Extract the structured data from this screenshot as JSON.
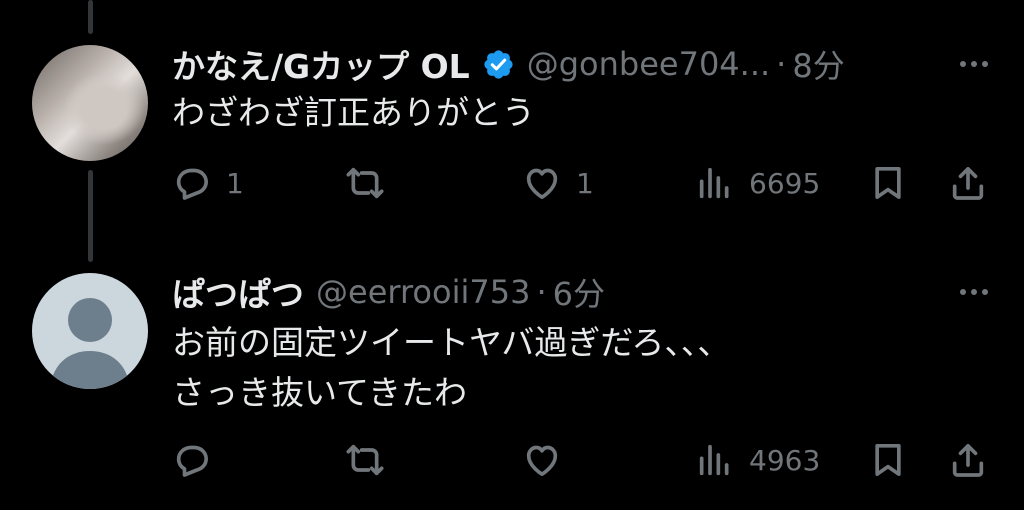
{
  "tweets": [
    {
      "display_name": "かなえ/Gカップ OL",
      "verified": true,
      "handle": "@gonbee704...",
      "dot": "·",
      "time": "8分",
      "text_lines": [
        "わざわざ訂正ありがとう"
      ],
      "reply_count": "1",
      "retweet_count": "",
      "like_count": "1",
      "view_count": "6695"
    },
    {
      "display_name": "ぱつぱつ",
      "verified": false,
      "handle": "@eerrooii753",
      "dot": "·",
      "time": "6分",
      "text_lines": [
        "お前の固定ツイートヤバ過ぎだろ、、、",
        "さっき抜いてきたわ"
      ],
      "reply_count": "",
      "retweet_count": "",
      "like_count": "",
      "view_count": "4963"
    }
  ],
  "icons": {
    "reply": "reply-icon",
    "retweet": "retweet-icon",
    "like": "heart-icon",
    "views": "views-icon",
    "bookmark": "bookmark-icon",
    "share": "share-icon",
    "more": "more-icon",
    "verified": "verified-badge-icon"
  },
  "colors": {
    "background": "#000000",
    "text": "#e7e9ea",
    "muted": "#71767b",
    "verified": "#1d9bf0",
    "thread_line": "#333639"
  }
}
